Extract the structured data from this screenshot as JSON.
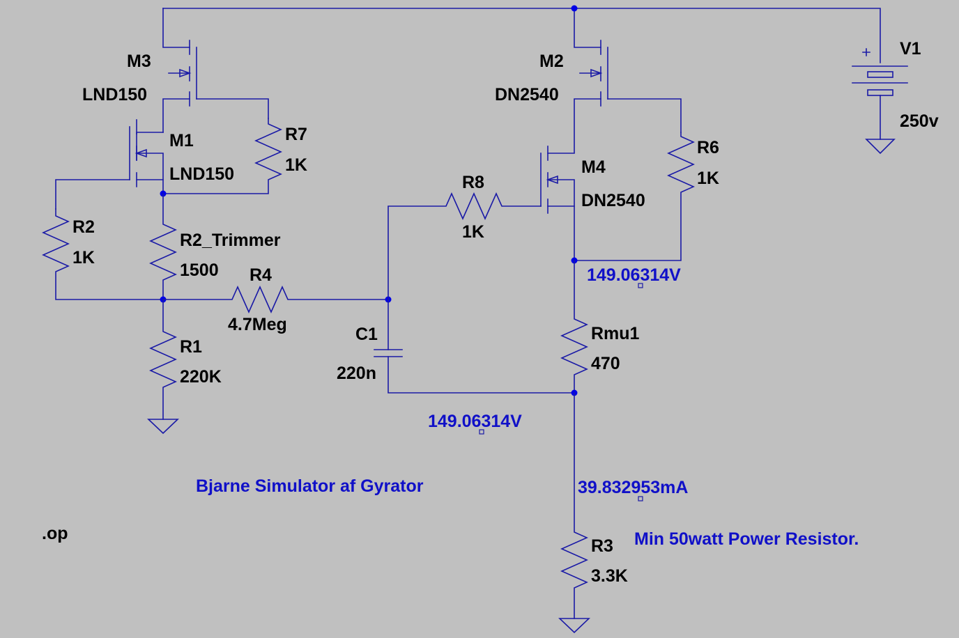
{
  "components": {
    "M3": {
      "ref": "M3",
      "model": "LND150"
    },
    "M1": {
      "ref": "M1",
      "model": "LND150"
    },
    "M2": {
      "ref": "M2",
      "model": "DN2540"
    },
    "M4": {
      "ref": "M4",
      "model": "DN2540"
    },
    "R7": {
      "ref": "R7",
      "value": "1K"
    },
    "R6": {
      "ref": "R6",
      "value": "1K"
    },
    "R8": {
      "ref": "R8",
      "value": "1K"
    },
    "R2": {
      "ref": "R2",
      "value": "1K"
    },
    "R2_Trimmer": {
      "ref": "R2_Trimmer",
      "value": "1500"
    },
    "R4": {
      "ref": "R4",
      "value": "4.7Meg"
    },
    "R1": {
      "ref": "R1",
      "value": "220K"
    },
    "C1": {
      "ref": "C1",
      "value": "220n"
    },
    "Rmu1": {
      "ref": "Rmu1",
      "value": "470"
    },
    "R3": {
      "ref": "R3",
      "value": "3.3K"
    },
    "V1": {
      "ref": "V1",
      "value": "250v"
    }
  },
  "probes": {
    "source_voltage": "149.06314V",
    "output_voltage": "149.06314V",
    "current": "39.832953mA"
  },
  "notes": {
    "title": "Bjarne Simulator af Gyrator",
    "power_note": "Min 50watt Power Resistor.",
    "directive": ".op"
  },
  "colors": {
    "background": "#c0c0c0",
    "wire": "#1a1aa6",
    "junction": "#0000e6",
    "label": "#000000",
    "annotation": "#1010c8"
  }
}
